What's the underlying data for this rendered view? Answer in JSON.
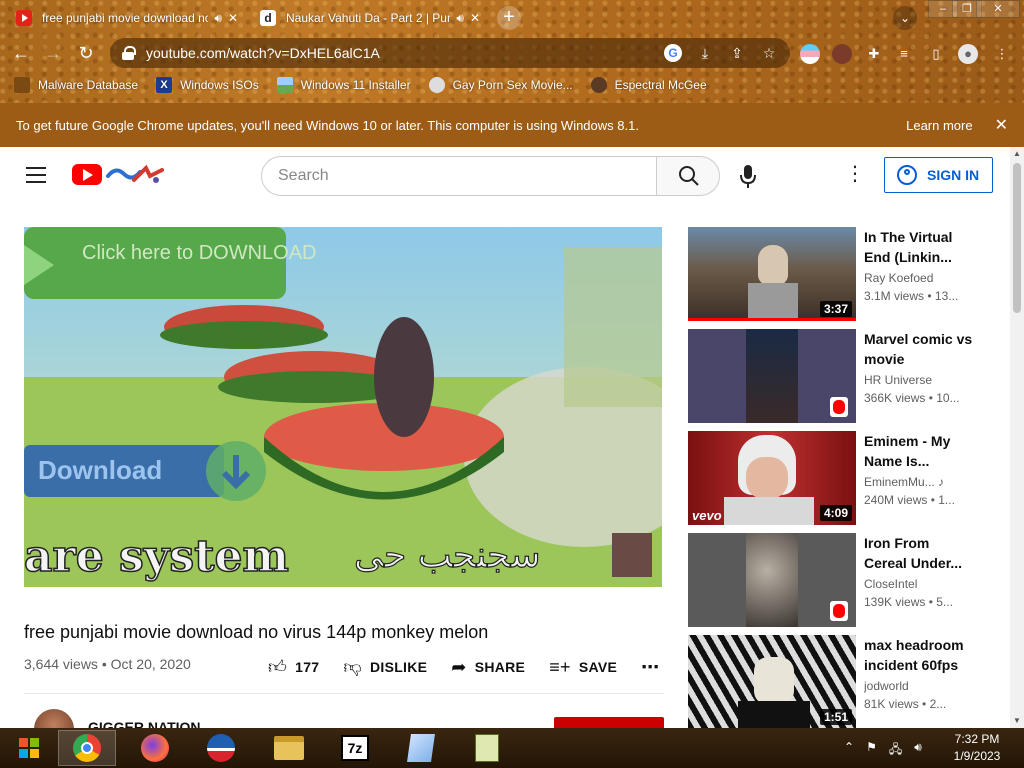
{
  "browser": {
    "tabs": [
      {
        "title": "free punjabi movie download no virus 144p monkey melon",
        "active": true,
        "favicon": "youtube-icon"
      },
      {
        "title": "Naukar Vahuti Da - Part 2 | Punjabi Movie",
        "active": false,
        "favicon": "dailymotion-icon"
      }
    ],
    "url": "youtube.com/watch?v=DxHEL6alC1A",
    "bookmarks": [
      {
        "label": "Malware Database",
        "icon": "bookmark-icon"
      },
      {
        "label": "Windows ISOs",
        "icon": "x-icon"
      },
      {
        "label": "Windows 11 Installer",
        "icon": "image-icon"
      },
      {
        "label": "Gay Porn Sex Movie...",
        "icon": "globe-icon"
      },
      {
        "label": "Espectral McGee",
        "icon": "avatar-icon"
      }
    ],
    "infobar": {
      "message": "To get future Google Chrome updates, you'll need Windows 10 or later. This computer is using Windows 8.1.",
      "link": "Learn more"
    },
    "accent": "#b06a1e"
  },
  "youtube": {
    "search_placeholder": "Search",
    "signin_label": "SIGN IN",
    "player_overlay": {
      "top_button": "Click here to DOWNLOAD",
      "download_label": "Download",
      "bottom_text": "are system"
    },
    "video": {
      "title": "free punjabi movie download no virus 144p monkey melon",
      "views": "3,644 views",
      "date": "Oct 20, 2020",
      "likes": "177",
      "dislike_label": "DISLIKE",
      "share_label": "SHARE",
      "save_label": "SAVE",
      "channel": "GIGGER NATION"
    },
    "recommendations": [
      {
        "title": "In The Virtual End (Linkin...",
        "channel": "Ray Koefoed",
        "views": "3.1M views",
        "age": "13...",
        "duration": "3:37"
      },
      {
        "title": "Marvel comic vs movie",
        "channel": "HR Universe",
        "views": "366K views",
        "age": "10...",
        "duration": "",
        "shorts": true
      },
      {
        "title": "Eminem - My Name Is...",
        "channel": "EminemMu...",
        "views": "240M views",
        "age": "1...",
        "duration": "4:09",
        "brand": "vevo"
      },
      {
        "title": "Iron From Cereal Under...",
        "channel": "CloseIntel",
        "views": "139K views",
        "age": "5...",
        "duration": "",
        "shorts": true
      },
      {
        "title": "max headroom incident 60fps",
        "channel": "jodworld",
        "views": "81K views",
        "age": "2...",
        "duration": "1:51"
      }
    ]
  },
  "taskbar": {
    "apps": [
      "windows-start-icon",
      "chrome-icon",
      "firefox-icon",
      "obama-icon",
      "file-explorer-icon",
      "7zip-icon",
      "notepad-icon",
      "text-editor-icon"
    ],
    "time": "7:32 PM",
    "date": "1/9/2023"
  }
}
